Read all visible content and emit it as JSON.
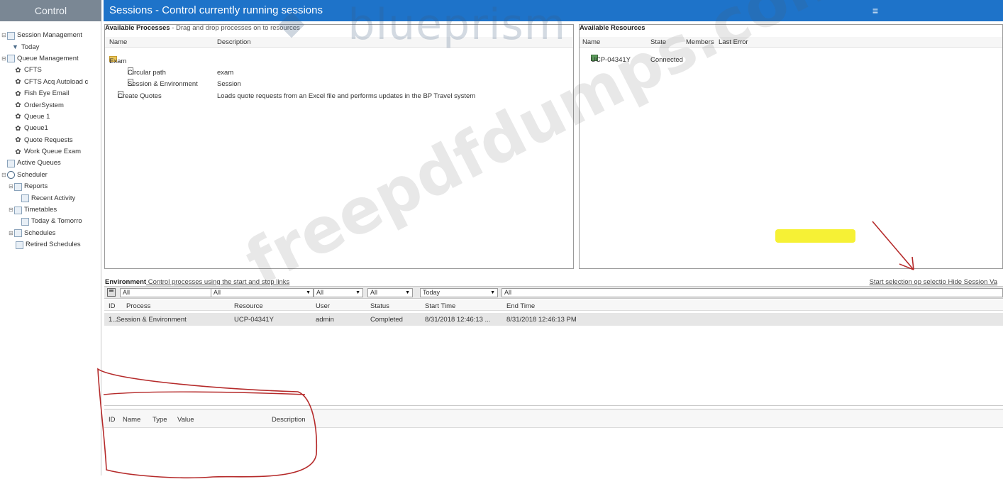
{
  "left_header": "Control",
  "nav": {
    "items": [
      {
        "label": "Session Management",
        "icon": "session-management-icon"
      },
      {
        "label": "Today",
        "icon": "filter-icon"
      },
      {
        "label": "Queue Management",
        "icon": "queue-management-icon"
      },
      {
        "label": "CFTS",
        "icon": "gear-icon"
      },
      {
        "label": "CFTS Acq Autoload c",
        "icon": "gear-icon"
      },
      {
        "label": "Fish Eye Email",
        "icon": "gear-icon"
      },
      {
        "label": "OrderSystem",
        "icon": "gear-icon"
      },
      {
        "label": "Queue 1",
        "icon": "gear-icon"
      },
      {
        "label": "Queue1",
        "icon": "gear-icon"
      },
      {
        "label": "Quote Requests",
        "icon": "gear-icon"
      },
      {
        "label": "Work Queue Exam",
        "icon": "gear-icon"
      },
      {
        "label": "Active Queues",
        "icon": "active-queues-icon"
      },
      {
        "label": "Scheduler",
        "icon": "clock-icon"
      },
      {
        "label": "Reports",
        "icon": "reports-icon"
      },
      {
        "label": "Recent Activity",
        "icon": "report-icon"
      },
      {
        "label": "Timetables",
        "icon": "timetables-icon"
      },
      {
        "label": "Today & Tomorro",
        "icon": "calendar-icon"
      },
      {
        "label": "Schedules",
        "icon": "schedules-icon"
      },
      {
        "label": "Retired Schedules",
        "icon": "retired-schedules-icon"
      }
    ]
  },
  "header": {
    "title": "Sessions - Control currently running sessions",
    "menu_icon": "hamburger-icon"
  },
  "processes": {
    "title": "Available Processes",
    "subtitle": " - Drag and drop processes on to resources",
    "col_name": "Name",
    "col_desc": "Description",
    "rows": [
      {
        "name": "Exam",
        "desc": ""
      },
      {
        "name": "Circular path",
        "desc": "exam"
      },
      {
        "name": "Session & Environment",
        "desc": "Session"
      },
      {
        "name": "Create Quotes",
        "desc": "Loads quote requests from an Excel file and performs updates in the BP Travel system"
      }
    ]
  },
  "resources": {
    "title": "Available Resources",
    "col_name": "Name",
    "col_state": "State",
    "col_members": "Members",
    "col_last_error": "Last Error",
    "rows": [
      {
        "name": "UCP-04341Y",
        "state": "Connected"
      }
    ]
  },
  "environment": {
    "title": "Environment",
    "subtitle": " Control processes using the start and stop links",
    "links": "Start selection  op selectio  Hide Session Va",
    "filters": [
      "All",
      "All",
      "All",
      "All",
      "Today",
      "All"
    ],
    "columns": [
      "ID",
      "Process",
      "Resource",
      "User",
      "Status",
      "Start Time",
      "End Time"
    ],
    "rows": [
      {
        "id": "1...",
        "process": "Session & Environment",
        "resource": "UCP-04341Y",
        "user": "admin",
        "status": "Completed",
        "start": "8/31/2018 12:46:13 ...",
        "end": "8/31/2018 12:46:13 PM"
      }
    ]
  },
  "props": {
    "columns": [
      "ID",
      "Name",
      "Type",
      "Value",
      "Description"
    ]
  },
  "watermarks": {
    "logo": "blueprism",
    "site": "freepdfdumps.com"
  },
  "colors": {
    "header_blue": "#1e73c9",
    "left_header": "#7a8794",
    "highlight": "#f6f02a",
    "annotation_red": "#b52a2a"
  }
}
